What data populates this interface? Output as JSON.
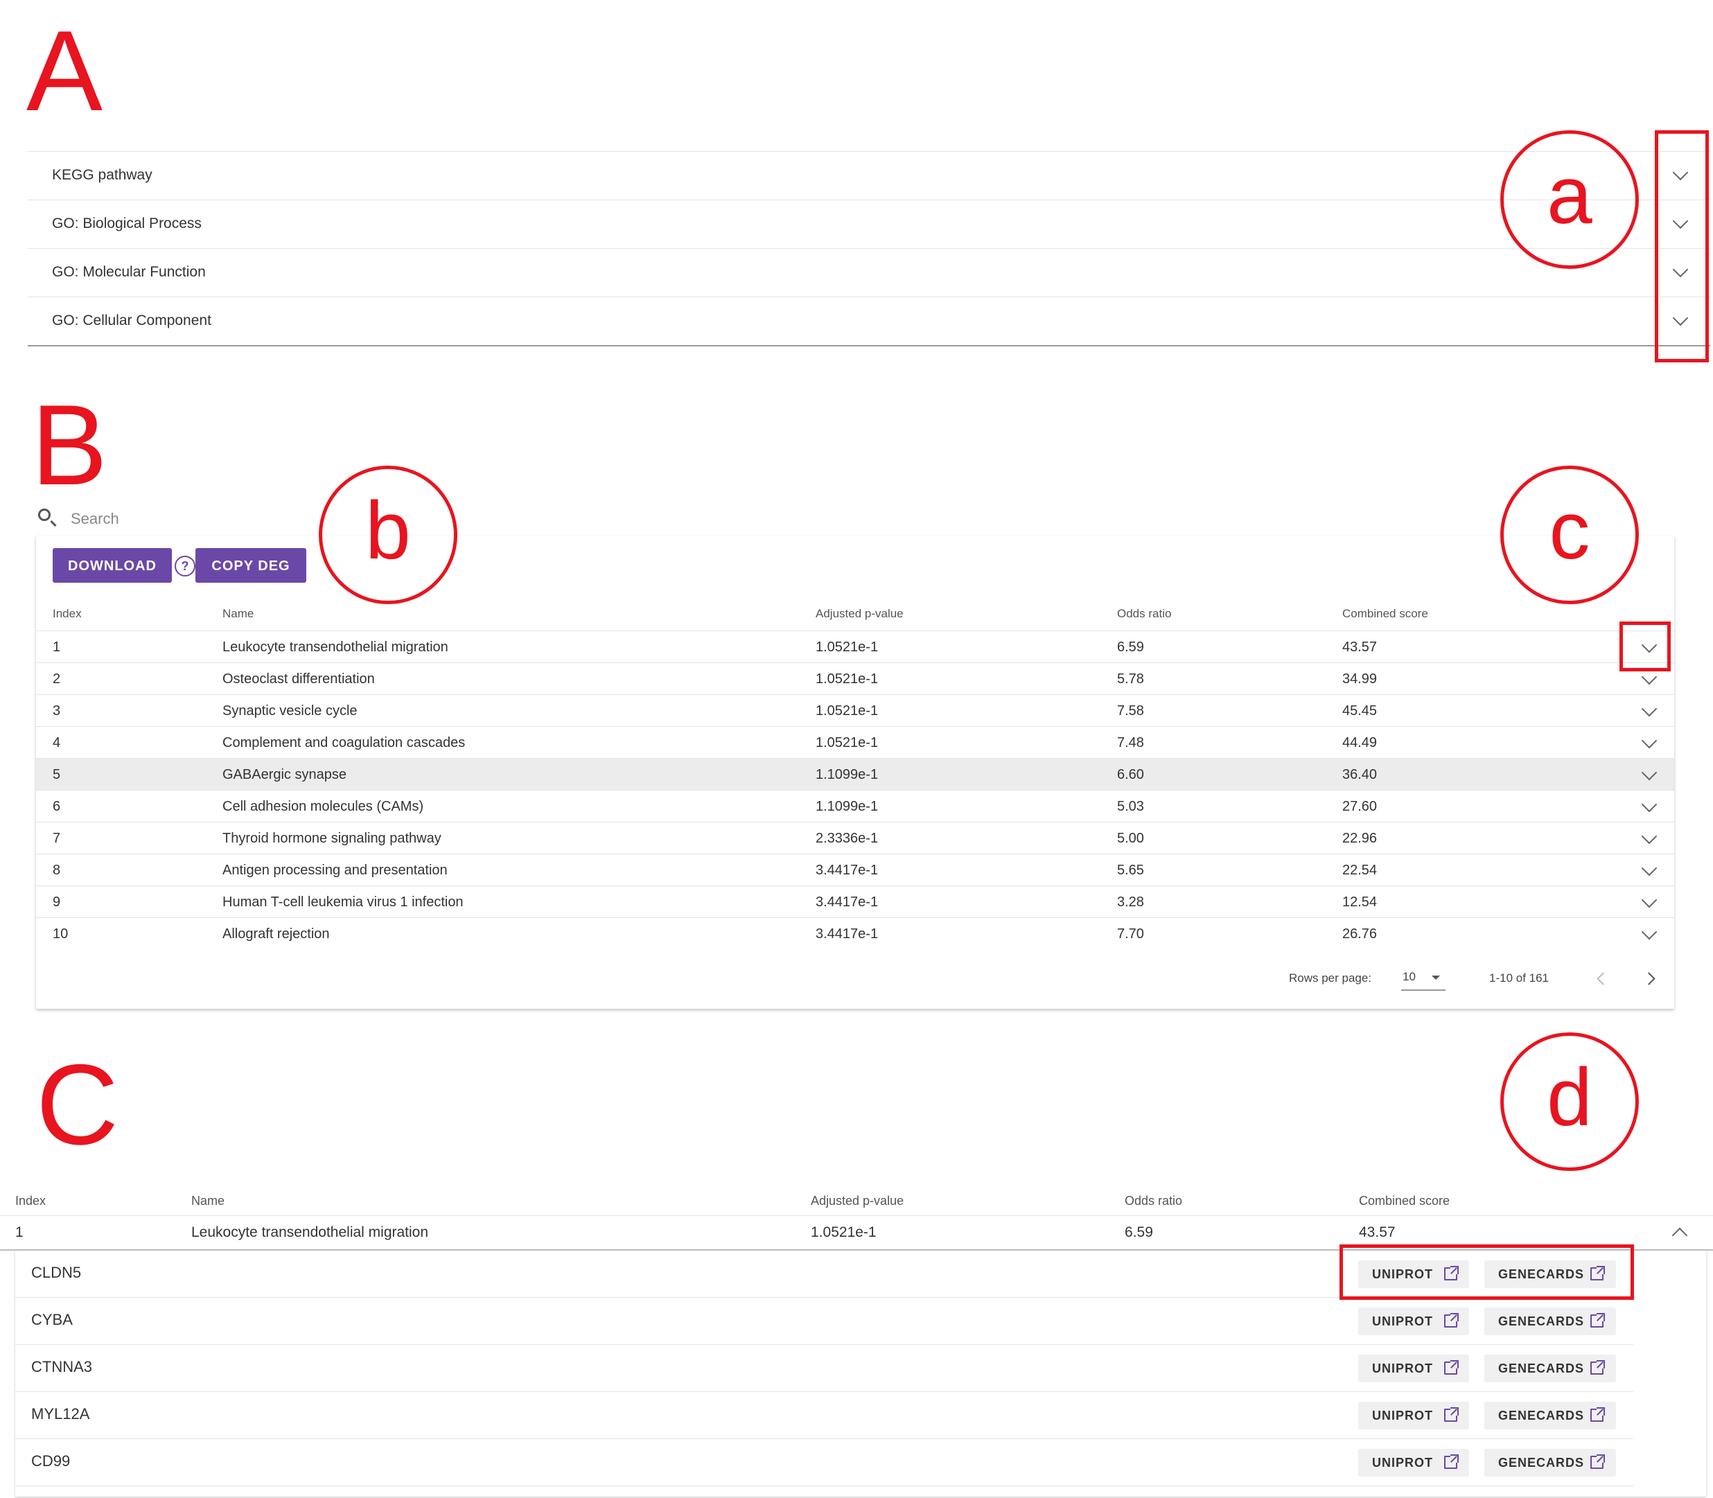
{
  "labels": {
    "panel_a": "A",
    "panel_b": "B",
    "panel_c": "C",
    "circle_a": "a",
    "circle_b": "b",
    "circle_c": "c",
    "circle_d": "d"
  },
  "accordion": {
    "items": [
      {
        "label": "KEGG pathway"
      },
      {
        "label": "GO: Biological Process"
      },
      {
        "label": "GO: Molecular Function"
      },
      {
        "label": "GO: Cellular Component"
      }
    ]
  },
  "search": {
    "placeholder": "Search"
  },
  "toolbar": {
    "download_label": "DOWNLOAD",
    "help_label": "?",
    "copy_label": "COPY DEG"
  },
  "table": {
    "headers": [
      "Index",
      "Name",
      "Adjusted p-value",
      "Odds ratio",
      "Combined score"
    ],
    "rows": [
      [
        "1",
        "Leukocyte transendothelial migration",
        "1.0521e-1",
        "6.59",
        "43.57"
      ],
      [
        "2",
        "Osteoclast differentiation",
        "1.0521e-1",
        "5.78",
        "34.99"
      ],
      [
        "3",
        "Synaptic vesicle cycle",
        "1.0521e-1",
        "7.58",
        "45.45"
      ],
      [
        "4",
        "Complement and coagulation cascades",
        "1.0521e-1",
        "7.48",
        "44.49"
      ],
      [
        "5",
        "GABAergic synapse",
        "1.1099e-1",
        "6.60",
        "36.40"
      ],
      [
        "6",
        "Cell adhesion molecules (CAMs)",
        "1.1099e-1",
        "5.03",
        "27.60"
      ],
      [
        "7",
        "Thyroid hormone signaling pathway",
        "2.3336e-1",
        "5.00",
        "22.96"
      ],
      [
        "8",
        "Antigen processing and presentation",
        "3.4417e-1",
        "5.65",
        "22.54"
      ],
      [
        "9",
        "Human T-cell leukemia virus 1 infection",
        "3.4417e-1",
        "3.28",
        "12.54"
      ],
      [
        "10",
        "Allograft rejection",
        "3.4417e-1",
        "7.70",
        "26.76"
      ]
    ],
    "footer": {
      "rows_per_page_label": "Rows per page:",
      "rows_per_page_value": "10",
      "range": "1-10 of 161"
    }
  },
  "expanded": {
    "headers": [
      "Index",
      "Name",
      "Adjusted p-value",
      "Odds ratio",
      "Combined score"
    ],
    "row": [
      "1",
      "Leukocyte transendothelial migration",
      "1.0521e-1",
      "6.59",
      "43.57"
    ],
    "genes": [
      {
        "name": "CLDN5",
        "uniprot": "UNIPROT",
        "genecards": "GENECARDS"
      },
      {
        "name": "CYBA",
        "uniprot": "UNIPROT",
        "genecards": "GENECARDS"
      },
      {
        "name": "CTNNA3",
        "uniprot": "UNIPROT",
        "genecards": "GENECARDS"
      },
      {
        "name": "MYL12A",
        "uniprot": "UNIPROT",
        "genecards": "GENECARDS"
      },
      {
        "name": "CD99",
        "uniprot": "UNIPROT",
        "genecards": "GENECARDS"
      }
    ]
  },
  "colors": {
    "accent": "#6a48a8",
    "annotation": "#e8141f",
    "shaded_row": "#ececec"
  }
}
